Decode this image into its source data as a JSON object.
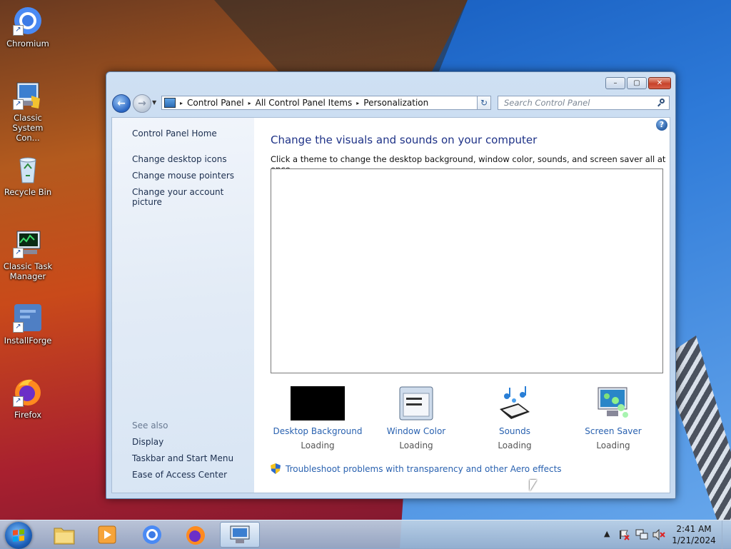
{
  "desktop": {
    "icons": [
      {
        "label": "Chromium",
        "icon": "chromium-icon"
      },
      {
        "label": "Classic System Con...",
        "icon": "control-panel-icon"
      },
      {
        "label": "Recycle Bin",
        "icon": "recycle-bin-icon"
      },
      {
        "label": "Classic Task Manager",
        "icon": "task-manager-icon"
      },
      {
        "label": "InstallForge",
        "icon": "installforge-icon"
      },
      {
        "label": "Firefox",
        "icon": "firefox-icon"
      }
    ]
  },
  "window": {
    "controls": {
      "minimize": "–",
      "maximize": "▢",
      "close": "✕"
    },
    "nav": {
      "back": "←",
      "forward": "→"
    },
    "address": {
      "crumbs": [
        "Control Panel",
        "All Control Panel Items",
        "Personalization"
      ],
      "separator": "▸",
      "dropdown": "▼"
    },
    "search": {
      "placeholder": "Search Control Panel"
    },
    "refresh": "↻",
    "left_pane": {
      "home": "Control Panel Home",
      "links": [
        "Change desktop icons",
        "Change mouse pointers",
        "Change your account picture"
      ],
      "see_also_heading": "See also",
      "see_also": [
        "Display",
        "Taskbar and Start Menu",
        "Ease of Access Center"
      ]
    },
    "main": {
      "help": "?",
      "title": "Change the visuals and sounds on your computer",
      "subtitle": "Click a theme to change the desktop background, window color, sounds, and screen saver all at once.",
      "options": [
        {
          "label": "Desktop Background",
          "status": "Loading"
        },
        {
          "label": "Window Color",
          "status": "Loading"
        },
        {
          "label": "Sounds",
          "status": "Loading"
        },
        {
          "label": "Screen Saver",
          "status": "Loading"
        }
      ],
      "troubleshoot": "Troubleshoot problems with transparency and other Aero effects"
    }
  },
  "taskbar": {
    "clock": {
      "time": "2:41 AM",
      "date": "1/21/2024"
    },
    "tray_arrow": "▲"
  }
}
